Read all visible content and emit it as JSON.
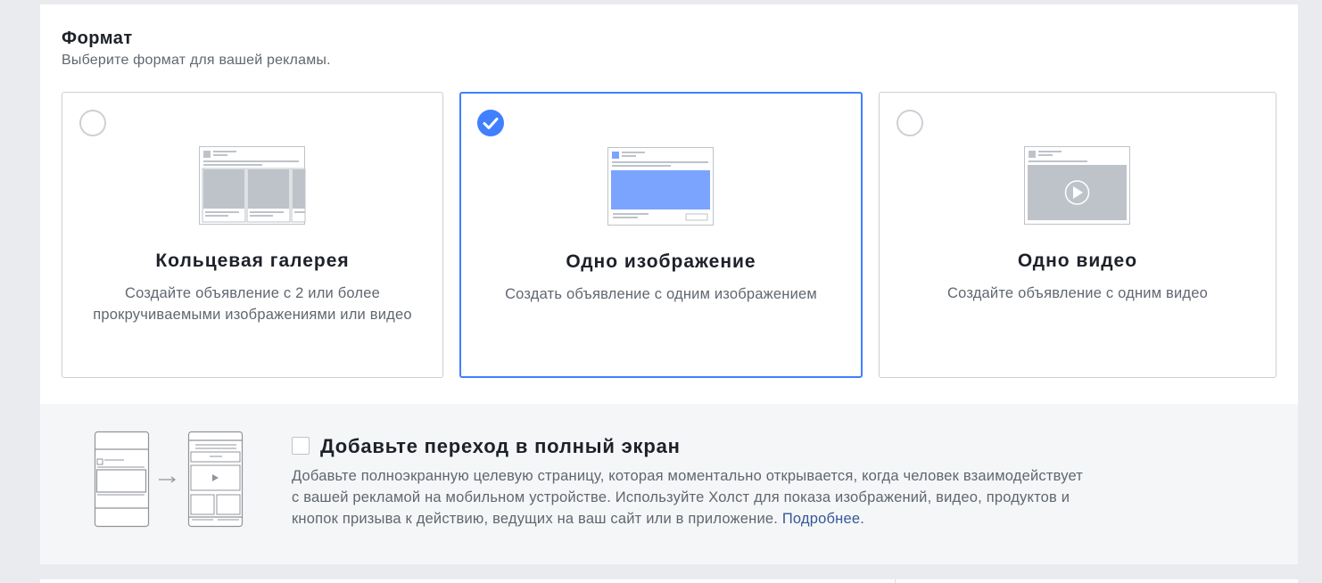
{
  "format": {
    "title": "Формат",
    "subtitle": "Выберите формат для вашей рекламы."
  },
  "cards": [
    {
      "title": "Кольцевая галерея",
      "description": "Создайте объявление с 2 или более прокручиваемыми изображениями или видео",
      "selected": false,
      "icon": "carousel-preview-icon"
    },
    {
      "title": "Одно изображение",
      "description": "Создать объявление с одним изображением",
      "selected": true,
      "icon": "single-image-preview-icon"
    },
    {
      "title": "Одно видео",
      "description": "Создайте объявление с одним видео",
      "selected": false,
      "icon": "single-video-preview-icon"
    }
  ],
  "fullscreen": {
    "title": "Добавьте переход в полный экран",
    "description": "Добавьте полноэкранную целевую страницу, которая моментально открывается, когда человек взаимодействует с вашей рекламой на мобильном устройстве. Используйте Холст для показа изображений, видео, продуктов и кнопок призыва к действию, ведущих на ваш сайт или в приложение.",
    "link_label": "Подробнее.",
    "checked": false,
    "icon": "canvas-transition-icon"
  },
  "colors": {
    "accent": "#4080ff",
    "link": "#365899",
    "border": "#ccd0d5",
    "muted_text": "#606770",
    "preview_gray": "#bec3c9"
  }
}
